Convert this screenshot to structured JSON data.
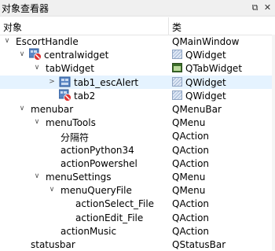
{
  "window": {
    "title": "对象查看器",
    "float_glyph": "⧉",
    "close_glyph": "✕"
  },
  "columns": {
    "object": "对象",
    "class": "类"
  },
  "rows": [
    {
      "name": "EscortHandle",
      "cls": "QMainWindow",
      "level": 0,
      "arrow": "down",
      "obj_icon": null,
      "cls_icon": null,
      "selected": false
    },
    {
      "name": "centralwidget",
      "cls": "QWidget",
      "level": 1,
      "arrow": "down",
      "obj_icon": "widget-blocked-icon",
      "cls_icon": "widget-class-icon",
      "selected": false
    },
    {
      "name": "tabWidget",
      "cls": "QTabWidget",
      "level": 2,
      "arrow": "down",
      "obj_icon": null,
      "cls_icon": "tabwidget-class-icon",
      "selected": false
    },
    {
      "name": "tab1_escAlert",
      "cls": "QWidget",
      "level": 3,
      "arrow": "right",
      "obj_icon": "widget-icon",
      "cls_icon": "widget-class-icon",
      "selected": true
    },
    {
      "name": "tab2",
      "cls": "QWidget",
      "level": 3,
      "arrow": null,
      "obj_icon": "widget-blocked-icon",
      "cls_icon": "widget-class-icon",
      "selected": false
    },
    {
      "name": "menubar",
      "cls": "QMenuBar",
      "level": 1,
      "arrow": "down",
      "obj_icon": null,
      "cls_icon": null,
      "selected": false
    },
    {
      "name": "menuTools",
      "cls": "QMenu",
      "level": 2,
      "arrow": "down",
      "obj_icon": null,
      "cls_icon": null,
      "selected": false
    },
    {
      "name": "分隔符",
      "cls": "QAction",
      "level": 3,
      "arrow": null,
      "obj_icon": null,
      "cls_icon": null,
      "selected": false
    },
    {
      "name": "actionPython34",
      "cls": "QAction",
      "level": 3,
      "arrow": null,
      "obj_icon": null,
      "cls_icon": null,
      "selected": false
    },
    {
      "name": "actionPowershel",
      "cls": "QAction",
      "level": 3,
      "arrow": null,
      "obj_icon": null,
      "cls_icon": null,
      "selected": false
    },
    {
      "name": "menuSettings",
      "cls": "QMenu",
      "level": 2,
      "arrow": "down",
      "obj_icon": null,
      "cls_icon": null,
      "selected": false
    },
    {
      "name": "menuQueryFile",
      "cls": "QMenu",
      "level": 3,
      "arrow": "down",
      "obj_icon": null,
      "cls_icon": null,
      "selected": false
    },
    {
      "name": "actionSelect_File",
      "cls": "QAction",
      "level": 4,
      "arrow": null,
      "obj_icon": null,
      "cls_icon": null,
      "selected": false
    },
    {
      "name": "actionEdit_File",
      "cls": "QAction",
      "level": 4,
      "arrow": null,
      "obj_icon": null,
      "cls_icon": null,
      "selected": false
    },
    {
      "name": "actionMusic",
      "cls": "QAction",
      "level": 3,
      "arrow": null,
      "obj_icon": null,
      "cls_icon": null,
      "selected": false
    },
    {
      "name": "statusbar",
      "cls": "QStatusBar",
      "level": 1,
      "arrow": null,
      "obj_icon": null,
      "cls_icon": null,
      "selected": false
    }
  ]
}
